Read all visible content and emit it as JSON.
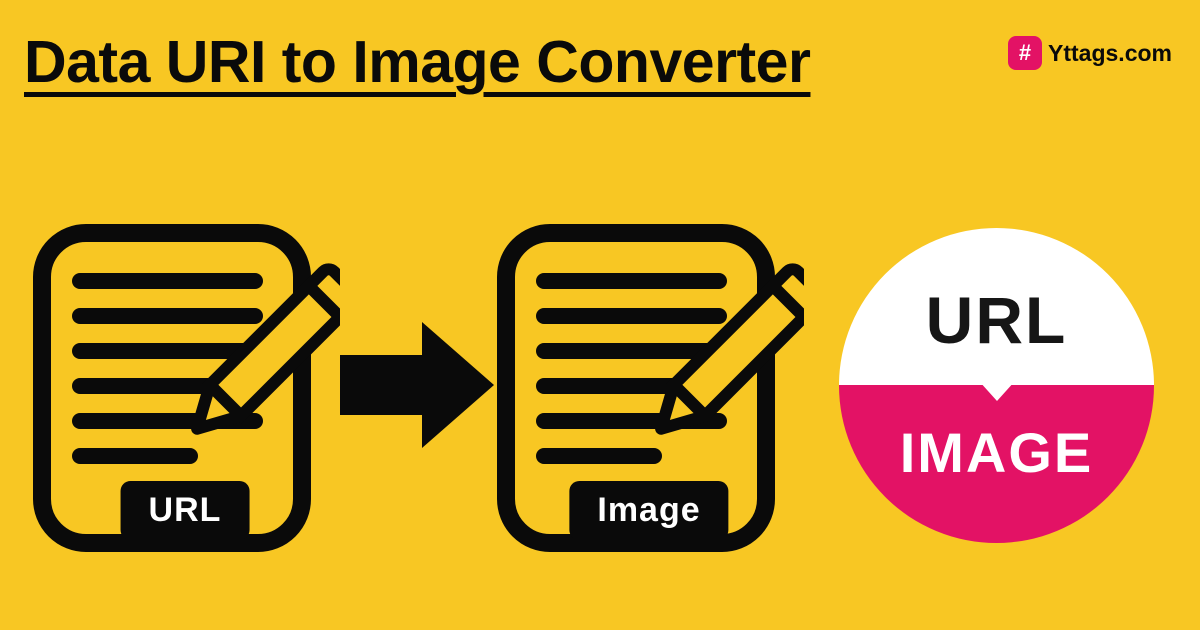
{
  "title": "Data URI to Image Converter",
  "brand": {
    "icon_glyph": "#",
    "text": "Yttags.com"
  },
  "diagram": {
    "left_badge": "URL",
    "right_badge": "Image",
    "circle_top": "URL",
    "circle_bottom": "IMAGE"
  }
}
